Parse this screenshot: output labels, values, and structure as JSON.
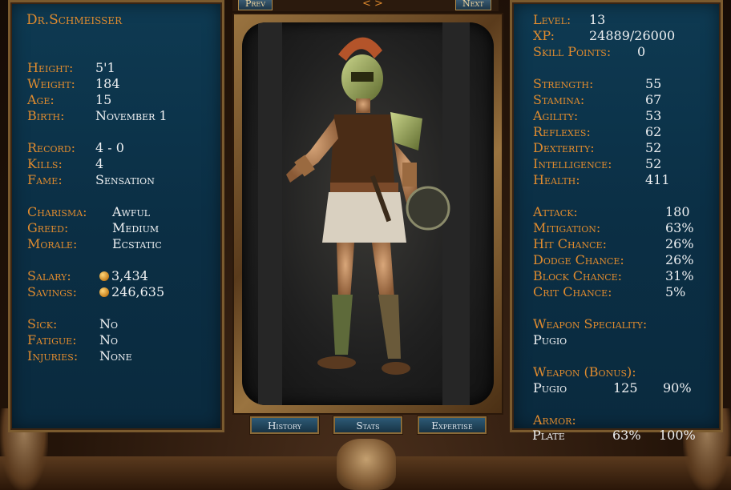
{
  "nav": {
    "prev": "Prev",
    "next": "Next",
    "arrows": "< >"
  },
  "tabs": {
    "history": "History",
    "stats": "Stats",
    "expertise": "Expertise"
  },
  "left": {
    "name": "Dr.Schmeisser",
    "height": {
      "label": "Height:",
      "value": "5'1"
    },
    "weight": {
      "label": "Weight:",
      "value": "184"
    },
    "age": {
      "label": "Age:",
      "value": "15"
    },
    "birth": {
      "label": "Birth:",
      "value": "November 1"
    },
    "record": {
      "label": "Record:",
      "value": "4 - 0"
    },
    "kills": {
      "label": "Kills:",
      "value": "4"
    },
    "fame": {
      "label": "Fame:",
      "value": "Sensation"
    },
    "charisma": {
      "label": "Charisma:",
      "value": "Awful"
    },
    "greed": {
      "label": "Greed:",
      "value": "Medium"
    },
    "morale": {
      "label": "Morale:",
      "value": "Ecstatic"
    },
    "salary": {
      "label": "Salary:",
      "value": "3,434"
    },
    "savings": {
      "label": "Savings:",
      "value": "246,635"
    },
    "sick": {
      "label": "Sick:",
      "value": "No"
    },
    "fatigue": {
      "label": "Fatigue:",
      "value": "No"
    },
    "injuries": {
      "label": "Injuries:",
      "value": "None"
    }
  },
  "right": {
    "level": {
      "label": "Level:",
      "value": "13"
    },
    "xp": {
      "label": "XP:",
      "value": "24889/26000"
    },
    "skill_points": {
      "label": "Skill Points:",
      "value": "0"
    },
    "strength": {
      "label": "Strength:",
      "value": "55"
    },
    "stamina": {
      "label": "Stamina:",
      "value": "67"
    },
    "agility": {
      "label": "Agility:",
      "value": "53"
    },
    "reflexes": {
      "label": "Reflexes:",
      "value": "62"
    },
    "dexterity": {
      "label": "Dexterity:",
      "value": "52"
    },
    "intelligence": {
      "label": "Intelligence:",
      "value": "52"
    },
    "health": {
      "label": "Health:",
      "value": "411"
    },
    "attack": {
      "label": "Attack:",
      "value": "180"
    },
    "mitigation": {
      "label": "Mitigation:",
      "value": "63%"
    },
    "hit_chance": {
      "label": "Hit Chance:",
      "value": "26%"
    },
    "dodge_chance": {
      "label": "Dodge Chance:",
      "value": "26%"
    },
    "block_chance": {
      "label": "Block Chance:",
      "value": "31%"
    },
    "crit_chance": {
      "label": "Crit Chance:",
      "value": "5%"
    },
    "weapon_speciality": {
      "label": "Weapon Speciality:",
      "value": "Pugio"
    },
    "weapon_bonus": {
      "label": "Weapon (Bonus):",
      "name": "Pugio",
      "value1": "125",
      "value2": "90%"
    },
    "armor": {
      "label": "Armor:",
      "name": "Plate",
      "value1": "63%",
      "value2": "100%"
    }
  },
  "colors": {
    "label": "#e08b2e",
    "value": "#eef0f2",
    "panel": "#0e3a52",
    "frame": "#9a7440"
  },
  "icons": {
    "coin": "gold-coin-icon",
    "portrait": "gladiator-portrait",
    "emblem": "lion-head-emblem"
  }
}
